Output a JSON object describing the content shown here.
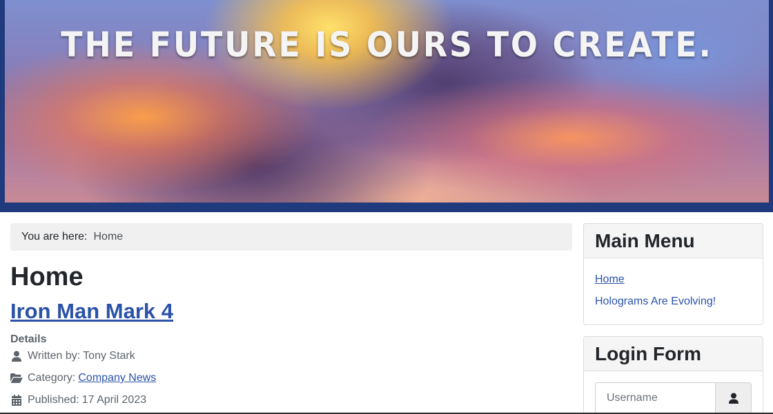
{
  "banner": {
    "title": "THE FUTURE IS OURS TO CREATE."
  },
  "breadcrumb": {
    "prefix": "You are here:",
    "current": "Home"
  },
  "page": {
    "heading": "Home"
  },
  "article": {
    "title": "Iron Man Mark 4",
    "details_label": "Details",
    "written_by_label": "Written by:",
    "author": "Tony Stark",
    "category_label": "Category:",
    "category": "Company News",
    "published_label": "Published:",
    "published_date": "17 April 2023"
  },
  "sidebar": {
    "main_menu": {
      "title": "Main Menu",
      "items": [
        {
          "label": "Home"
        },
        {
          "label": "Holograms Are Evolving!"
        }
      ]
    },
    "login_form": {
      "title": "Login Form",
      "username_placeholder": "Username",
      "username_value": ""
    }
  },
  "icons": {
    "author": "user-icon",
    "category": "folder-open-icon",
    "published": "calendar-icon",
    "username_addon": "user-icon"
  },
  "colors": {
    "header_background": "#1f3b7e",
    "link": "#2a52a8",
    "breadcrumb_background": "#f0f0f0",
    "card_header_background": "#f5f5f5"
  }
}
